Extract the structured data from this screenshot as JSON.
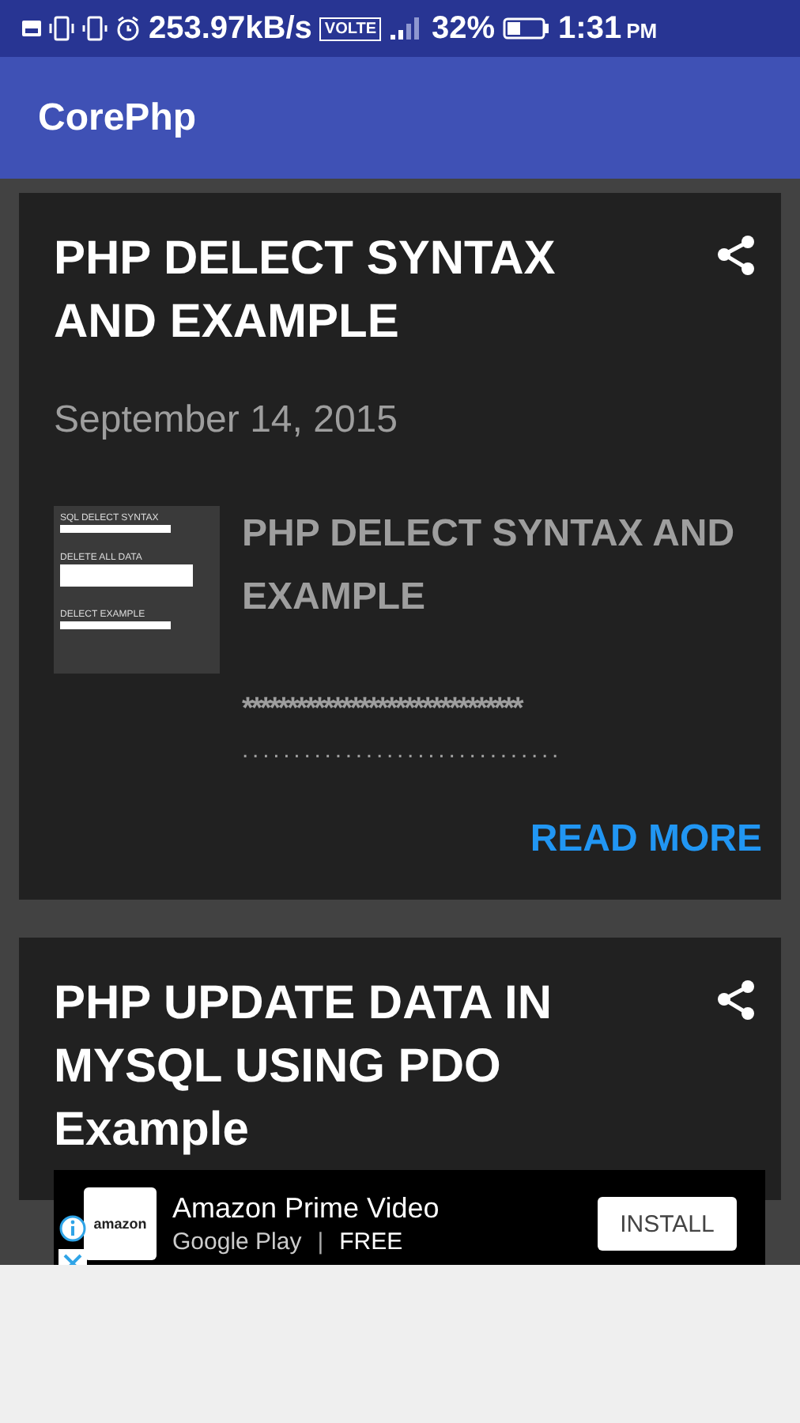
{
  "status_bar": {
    "speed": "253.97kB/s",
    "network_badge": "VOLTE",
    "battery": "32%",
    "time": "1:31",
    "meridiem": "PM"
  },
  "app_bar": {
    "title": "CorePhp"
  },
  "posts": [
    {
      "title": "PHP DELECT SYNTAX AND EXAMPLE",
      "date": "September 14, 2015",
      "thumbnail": {
        "labels": [
          "SQL DELECT SYNTAX",
          "DELETE  ALL  DATA",
          "DELECT EXAMPLE"
        ]
      },
      "excerpt": "PHP DELECT SYNTAX AND EXAMPLE",
      "stars_line": "*******************************",
      "dots_line": ". . . . . . . . . . . . . . . . . . . . . . . . . . . . . . .",
      "read_more": "READ MORE"
    },
    {
      "title": "PHP UPDATE DATA IN MYSQL USING PDO Example"
    }
  ],
  "ad": {
    "logo": "amazon",
    "title": "Amazon Prime Video",
    "store": "Google Play",
    "separator": "|",
    "price": "FREE",
    "button": "INSTALL"
  }
}
